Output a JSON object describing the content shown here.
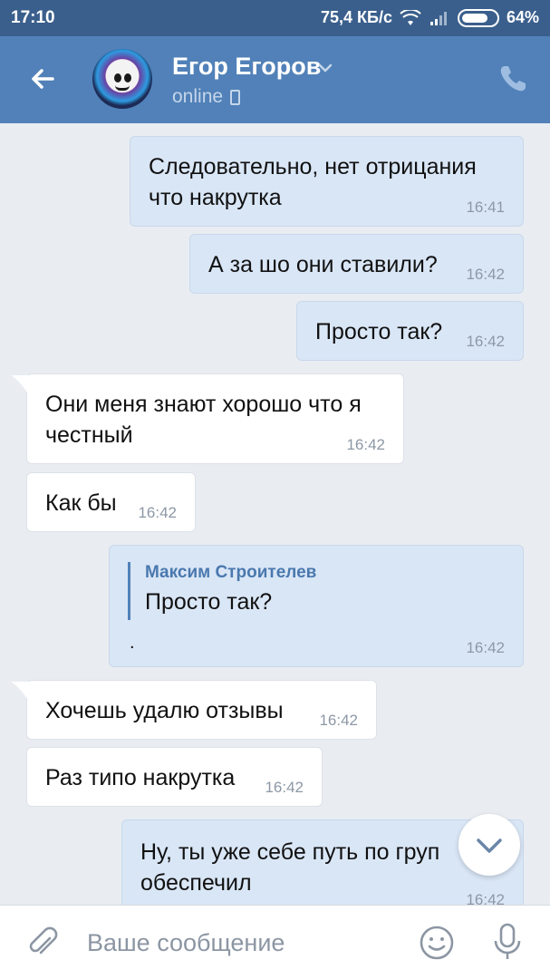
{
  "status_bar": {
    "time": "17:10",
    "speed": "75,4 КБ/с",
    "battery": "64%",
    "icons": [
      "wifi-icon",
      "signal-icon",
      "battery-icon"
    ]
  },
  "header": {
    "name": "Егор Егоров",
    "presence": "online",
    "icons": [
      "back-arrow-icon",
      "chevron-down-icon",
      "mobile-icon",
      "phone-icon"
    ],
    "colors": {
      "header_bg": "#5181b8",
      "status_bg": "#3a5f8c"
    }
  },
  "messages": [
    {
      "dir": "out",
      "text_lines": [
        "Следовательно, нет отрицания",
        "что накрутка"
      ],
      "time": "16:41"
    },
    {
      "dir": "out",
      "text_lines": [
        "А за шо они ставили?"
      ],
      "time": "16:42"
    },
    {
      "dir": "out",
      "text_lines": [
        "Просто так?"
      ],
      "time": "16:42"
    },
    {
      "dir": "in",
      "text_lines": [
        "Они меня знают хорошо что я",
        "честный"
      ],
      "time": "16:42"
    },
    {
      "dir": "in",
      "text_lines": [
        "Как бы"
      ],
      "time": "16:42"
    },
    {
      "dir": "out",
      "quote": {
        "author": "Максим Строителев",
        "text": "Просто так?"
      },
      "text_lines": [
        "."
      ],
      "time": "16:42"
    },
    {
      "dir": "in",
      "text_lines": [
        "Хочешь удалю отзывы"
      ],
      "time": "16:42"
    },
    {
      "dir": "in",
      "text_lines": [
        "Раз типо накрутка"
      ],
      "time": "16:42"
    },
    {
      "dir": "out",
      "text_lines": [
        "Ну, ты уже себе путь по груп",
        "обеспечил"
      ],
      "time": "16:42"
    }
  ],
  "input": {
    "placeholder": "Ваше сообщение",
    "icons": [
      "paperclip-icon",
      "emoji-icon",
      "microphone-icon"
    ]
  },
  "scroll_button_icon": "chevron-down-icon"
}
